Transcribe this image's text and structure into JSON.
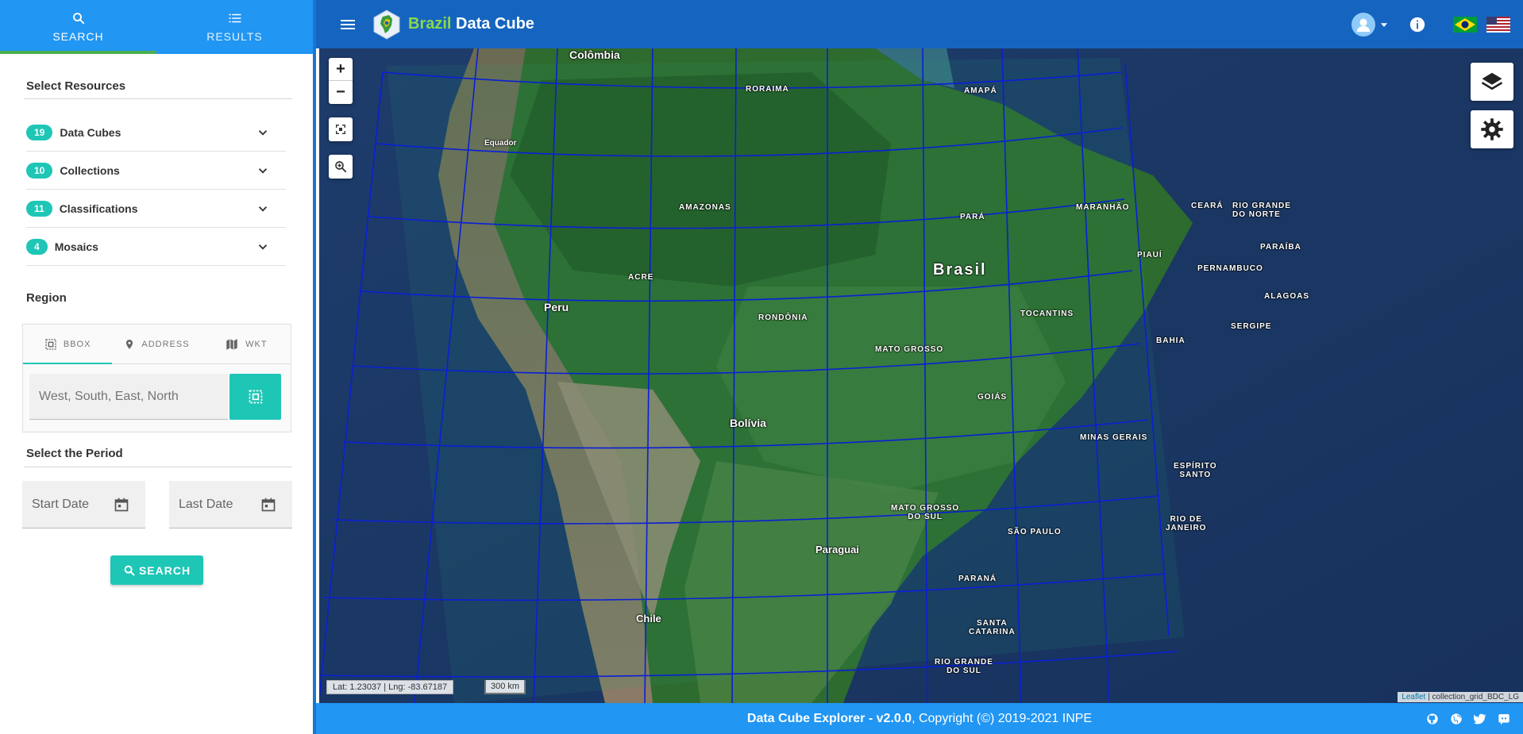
{
  "sidebar": {
    "tabs": [
      {
        "label": "SEARCH",
        "icon": "search-icon"
      },
      {
        "label": "RESULTS",
        "icon": "list-icon"
      }
    ],
    "resources_title": "Select Resources",
    "resources": [
      {
        "count": "19",
        "label": "Data Cubes"
      },
      {
        "count": "10",
        "label": "Collections"
      },
      {
        "count": "11",
        "label": "Classifications"
      },
      {
        "count": "4",
        "label": "Mosaics"
      }
    ],
    "region_title": "Region",
    "region_tabs": [
      {
        "label": "BBOX",
        "icon": "bbox-icon"
      },
      {
        "label": "ADDRESS",
        "icon": "location-pin-icon"
      },
      {
        "label": "WKT",
        "icon": "map-icon"
      }
    ],
    "bbox_placeholder": "West, South, East, North",
    "period_title": "Select the Period",
    "start_date_placeholder": "Start Date",
    "last_date_placeholder": "Last Date",
    "search_button": "SEARCH"
  },
  "header": {
    "brand_highlight": "Brazil",
    "brand_rest": " Data Cube",
    "accent_color": "#8bd84a",
    "bar_color": "#1565c0"
  },
  "map": {
    "labels": {
      "colombia": "Colômbia",
      "equador": "Equador",
      "roraima": "RORAIMA",
      "amapa": "AMAPÁ",
      "amazonas": "AMAZONAS",
      "para": "PARÁ",
      "maranhao": "MARANHÃO",
      "ceara": "CEARÁ",
      "rn": "RIO GRANDE\nDO NORTE",
      "paraiba": "PARAÍBA",
      "piaui": "PIAUÍ",
      "pernambuco": "PERNAMBUCO",
      "alagoas": "ALAGOAS",
      "sergipe": "SERGIPE",
      "acre": "ACRE",
      "brasil": "Brasil",
      "peru": "Peru",
      "rondonia": "RONDÔNIA",
      "tocantins": "TOCANTINS",
      "bahia": "BAHIA",
      "mato_grosso": "MATO GROSSO",
      "goias": "GOIÁS",
      "bolivia": "Bolívia",
      "minas": "MINAS GERAIS",
      "es": "ESPÍRITO\nSANTO",
      "ms": "MATO GROSSO\nDO SUL",
      "sp": "SÃO PAULO",
      "rj": "RIO DE\nJANEIRO",
      "paraguai": "Paraguai",
      "parana": "PARANÁ",
      "sc": "SANTA\nCATARINA",
      "chile": "Chile",
      "rs": "RIO GRANDE\nDO SUL"
    },
    "coords": "Lat: 1.23037 | Lng: -83.67187",
    "scale": "300 km",
    "attrib_link": "Leaflet",
    "attrib_text": " | collection_grid_BDC_LG",
    "grid_color": "#0a1fd6"
  },
  "footer": {
    "app_name": "Data Cube Explorer - v2.0.0",
    "copyright": ", Copyright (©) 2019-2021 INPE"
  }
}
